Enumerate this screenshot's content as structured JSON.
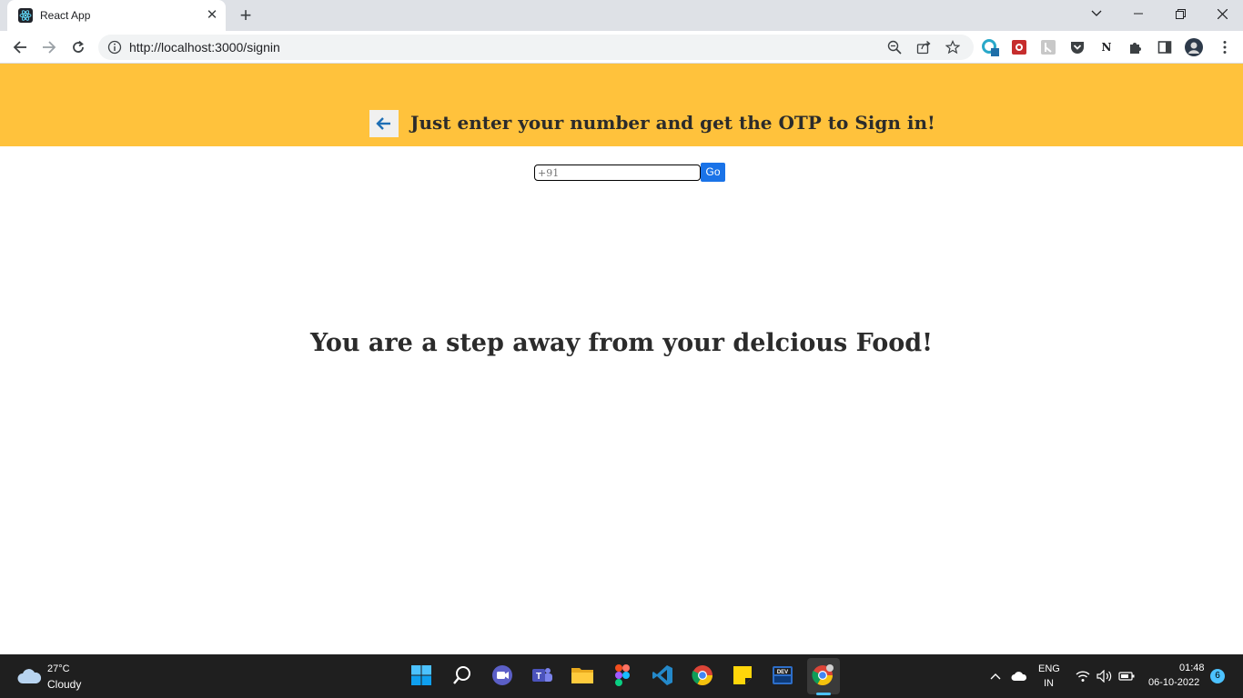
{
  "browser": {
    "tab_title": "React App",
    "url": "http://localhost:3000/signin",
    "tab_close_glyph": "✕",
    "new_tab_glyph": "+"
  },
  "page": {
    "header_text": "Just enter your number and get the OTP to Sign in!",
    "phone_placeholder": "+91",
    "go_label": "Go",
    "tagline": "You are a step away from your delcious Food!",
    "accent_color": "#ffc23c",
    "button_color": "#1a73e8"
  },
  "taskbar": {
    "temperature": "27°C",
    "weather": "Cloudy",
    "lang_line1": "ENG",
    "lang_line2": "IN",
    "time": "01:48",
    "date": "06-10-2022",
    "notification_count": "6"
  },
  "extensions": {
    "badge": "2",
    "notion_label": "N"
  }
}
